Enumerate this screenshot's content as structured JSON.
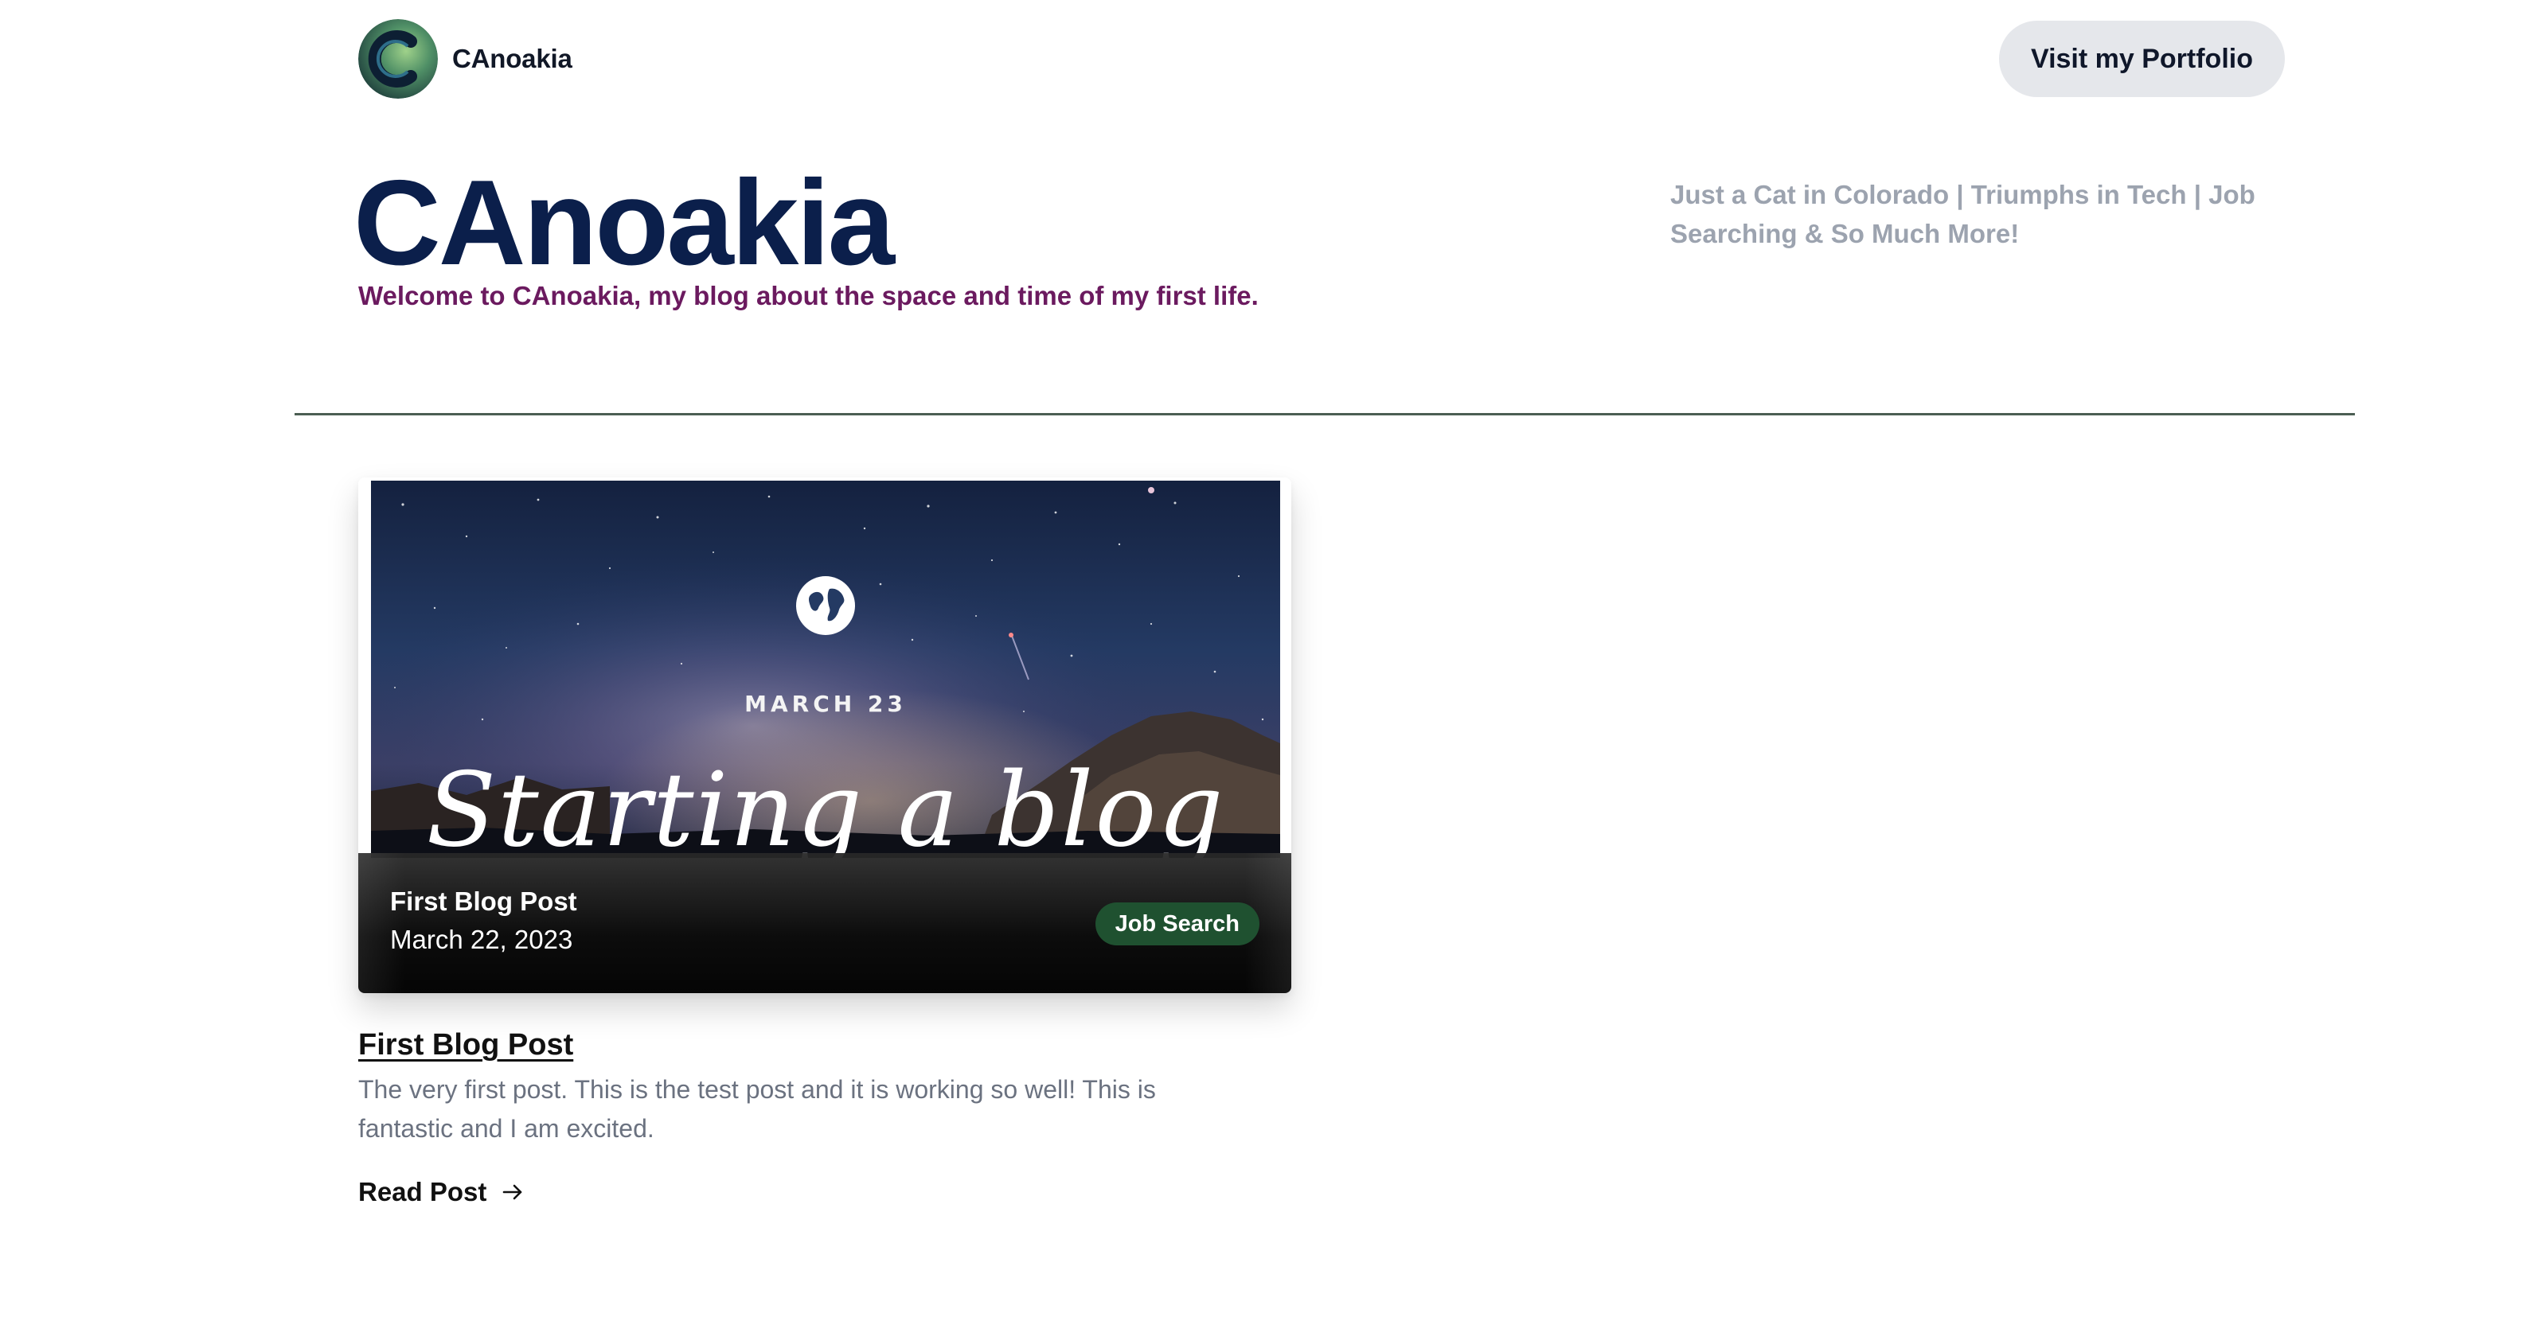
{
  "header": {
    "brand_name": "CAnoakia",
    "avatar_icon": "avatar-c-logo",
    "portfolio_button_label": "Visit my Portfolio"
  },
  "hero": {
    "title": "CAnoakia",
    "tagline": "Welcome to CAnoakia, my blog about the space and time of my first life.",
    "subtitle": "Just a Cat in Colorado | Triumphs in Tech | Job Searching & So Much More!"
  },
  "colors": {
    "title": "#0b1f4b",
    "tagline": "#6b1a5f",
    "subtitle": "#9ca3af",
    "button_bg": "#e5e7eb",
    "tag_bg": "#1f5130",
    "divider": "#4b5e53"
  },
  "posts": [
    {
      "cover": {
        "date_text": "MARCH 23",
        "title_text": "Starting a blog",
        "icon": "globe-icon"
      },
      "overlay_title": "First Blog Post",
      "overlay_date": "March 22, 2023",
      "tag": "Job Search",
      "title": "First Blog Post",
      "excerpt": "The very first post. This is the test post and it is working so well! This is fantastic and I am excited.",
      "read_label": "Read Post",
      "read_icon": "arrow-right-icon"
    }
  ]
}
